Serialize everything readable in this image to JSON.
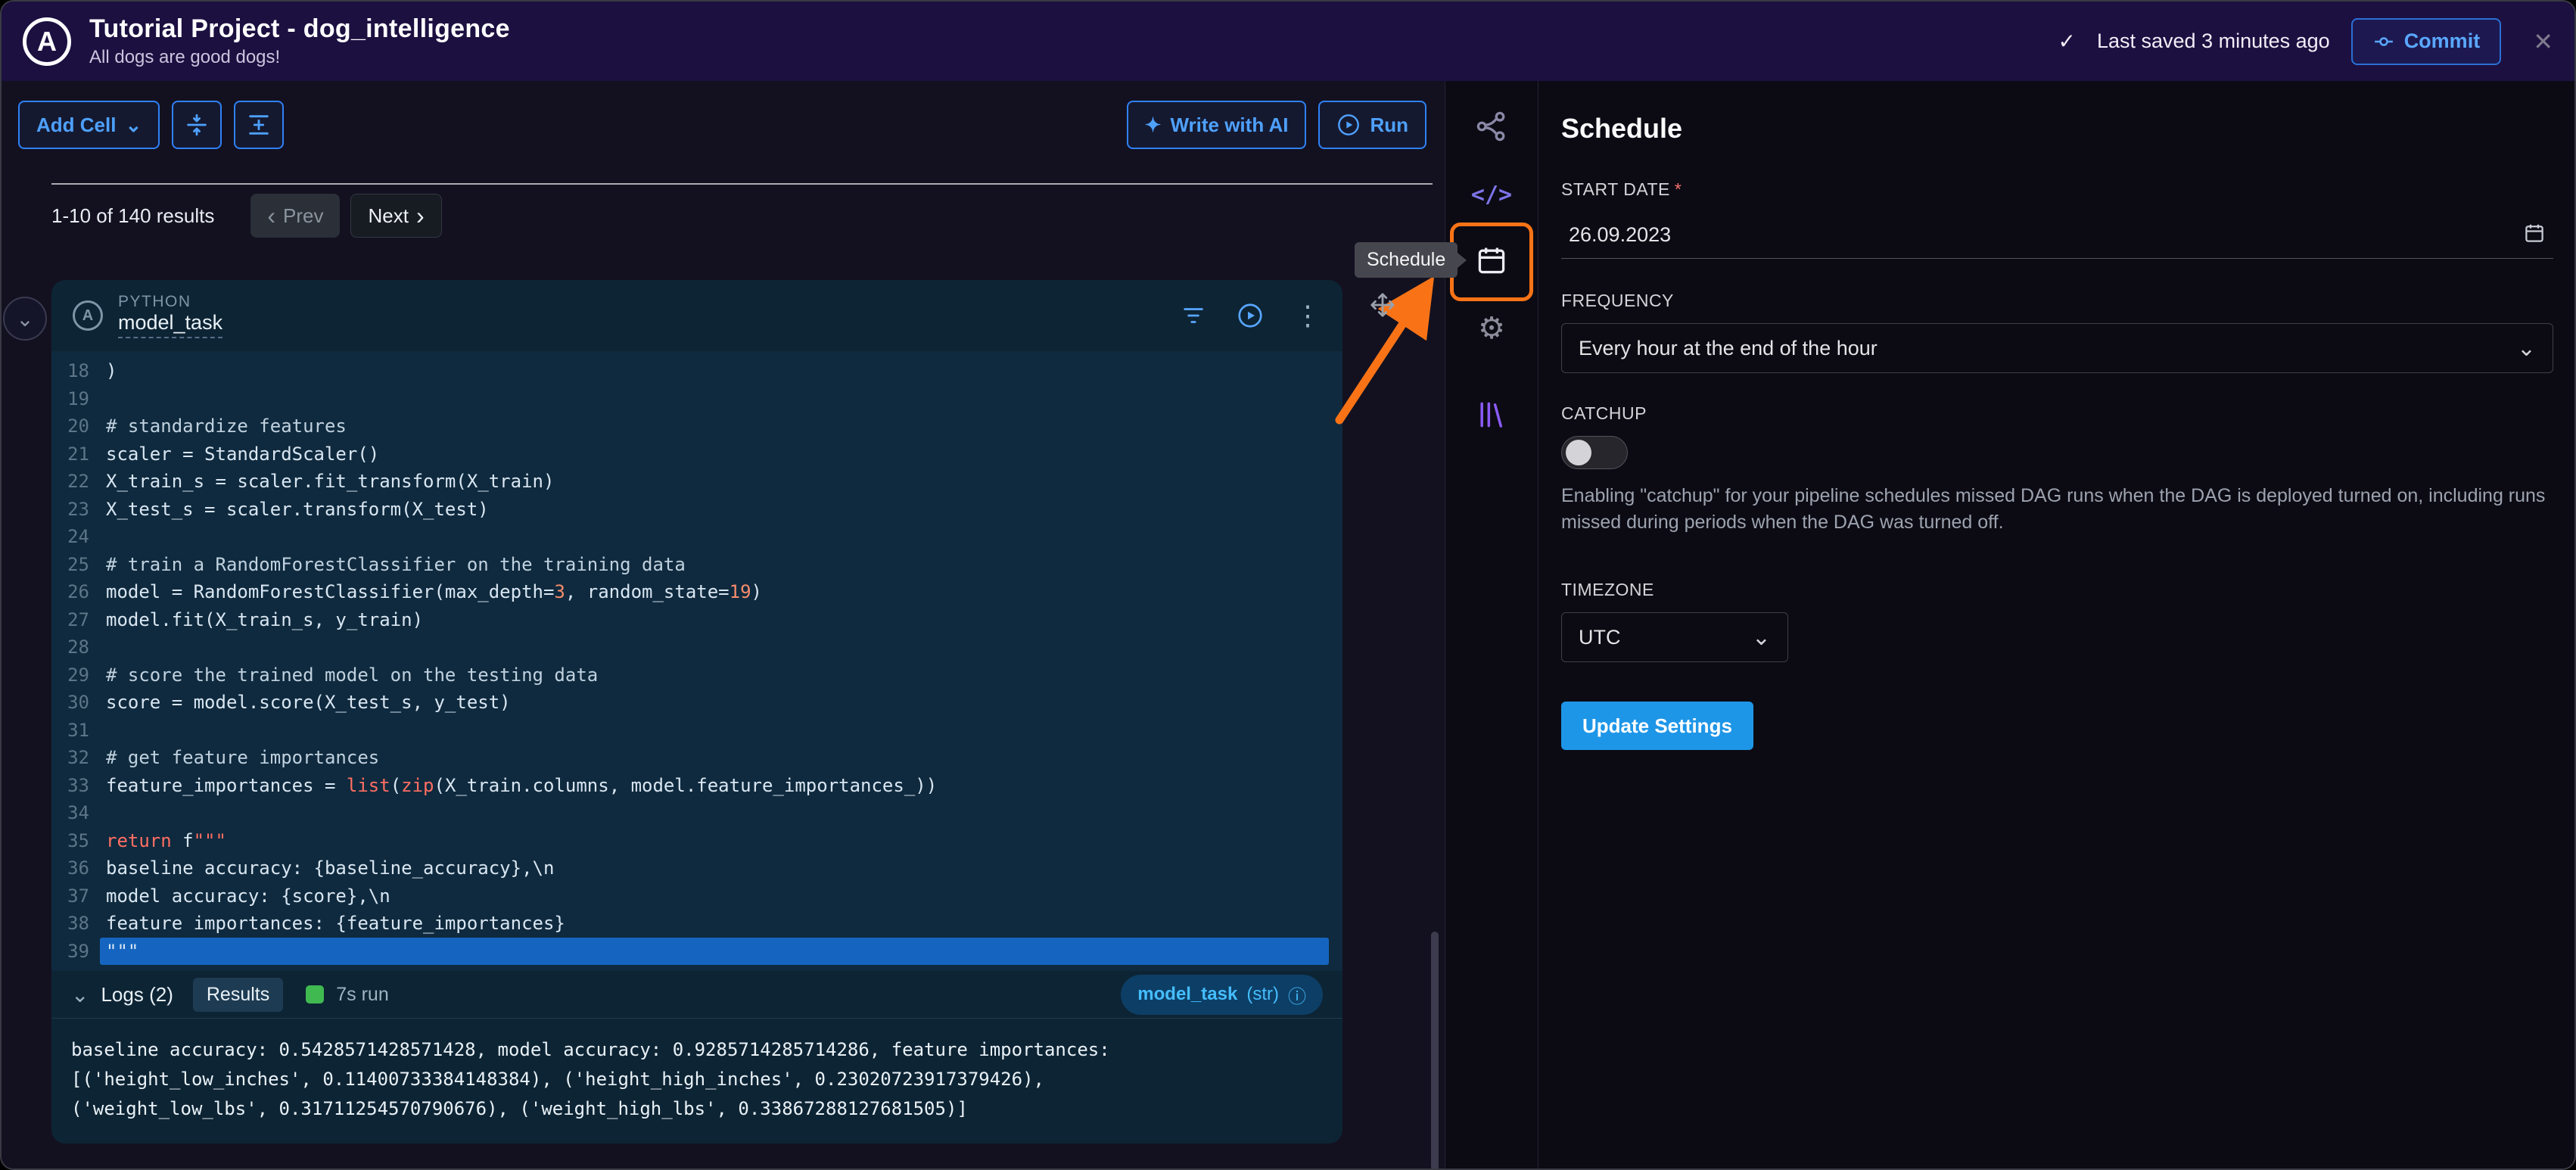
{
  "header": {
    "title": "Tutorial Project - dog_intelligence",
    "subtitle": "All dogs are good dogs!",
    "last_saved": "Last saved 3 minutes ago",
    "commit_label": "Commit"
  },
  "toolbar": {
    "add_cell": "Add Cell",
    "write_ai": "Write with AI",
    "run": "Run"
  },
  "results_bar": {
    "summary": "1-10 of 140 results",
    "prev": "Prev",
    "next": "Next"
  },
  "cell": {
    "language": "PYTHON",
    "name": "model_task",
    "code": [
      {
        "n": "18",
        "segs": [
          [
            "p",
            ")"
          ]
        ]
      },
      {
        "n": "19",
        "segs": []
      },
      {
        "n": "20",
        "segs": [
          [
            "c",
            "# standardize features"
          ]
        ]
      },
      {
        "n": "21",
        "segs": [
          [
            "p",
            "scaler = StandardScaler()"
          ]
        ]
      },
      {
        "n": "22",
        "segs": [
          [
            "p",
            "X_train_s = scaler.fit_transform(X_train)"
          ]
        ]
      },
      {
        "n": "23",
        "segs": [
          [
            "p",
            "X_test_s = scaler.transform(X_test)"
          ]
        ]
      },
      {
        "n": "24",
        "segs": []
      },
      {
        "n": "25",
        "segs": [
          [
            "c",
            "# train a RandomForestClassifier on the training data"
          ]
        ]
      },
      {
        "n": "26",
        "segs": [
          [
            "p",
            "model = RandomForestClassifier(max_depth="
          ],
          [
            "n",
            "3"
          ],
          [
            "p",
            ", random_state="
          ],
          [
            "n",
            "19"
          ],
          [
            "p",
            ")"
          ]
        ]
      },
      {
        "n": "27",
        "segs": [
          [
            "p",
            "model.fit(X_train_s, y_train)"
          ]
        ]
      },
      {
        "n": "28",
        "segs": []
      },
      {
        "n": "29",
        "segs": [
          [
            "c",
            "# score the trained model on the testing data"
          ]
        ]
      },
      {
        "n": "30",
        "segs": [
          [
            "p",
            "score = model.score(X_test_s, y_test)"
          ]
        ]
      },
      {
        "n": "31",
        "segs": []
      },
      {
        "n": "32",
        "segs": [
          [
            "c",
            "# get feature importances"
          ]
        ]
      },
      {
        "n": "33",
        "segs": [
          [
            "p",
            "feature_importances = "
          ],
          [
            "k",
            "list"
          ],
          [
            "p",
            "("
          ],
          [
            "k",
            "zip"
          ],
          [
            "p",
            "(X_train.columns, model.feature_importances_))"
          ]
        ]
      },
      {
        "n": "34",
        "segs": []
      },
      {
        "n": "35",
        "segs": [
          [
            "k",
            "return"
          ],
          [
            "p",
            " f"
          ],
          [
            "k",
            "\"\"\""
          ]
        ]
      },
      {
        "n": "36",
        "segs": [
          [
            "p",
            "baseline accuracy: {baseline_accuracy},\\n"
          ]
        ]
      },
      {
        "n": "37",
        "segs": [
          [
            "p",
            "model accuracy: {score},\\n"
          ]
        ]
      },
      {
        "n": "38",
        "segs": [
          [
            "p",
            "feature importances: {feature_importances}"
          ]
        ]
      },
      {
        "n": "39",
        "hl": true,
        "segs": [
          [
            "p",
            "\"\"\""
          ]
        ]
      }
    ],
    "footer": {
      "logs": "Logs (2)",
      "results_tab": "Results",
      "runtime": "7s run",
      "badge_name": "model_task",
      "badge_type": "(str)"
    },
    "output": [
      "baseline accuracy: 0.5428571428571428, model accuracy: 0.9285714285714286, feature importances:",
      "[('height_low_inches', 0.11400733384148384), ('height_high_inches', 0.23020723917379426),",
      "('weight_low_lbs', 0.31711254570790676), ('weight_high_lbs', 0.33867288127681505)]"
    ]
  },
  "rail": {
    "tooltip": "Schedule"
  },
  "panel": {
    "title": "Schedule",
    "start_date_label": "START DATE",
    "required_mark": "*",
    "start_date_value": "26.09.2023",
    "frequency_label": "FREQUENCY",
    "frequency_value": "Every hour at the end of the hour",
    "catchup_label": "CATCHUP",
    "catchup_description": "Enabling \"catchup\" for your pipeline schedules missed DAG runs when the DAG is deployed turned on, including runs missed during periods when the DAG was turned off.",
    "timezone_label": "TIMEZONE",
    "timezone_value": "UTC",
    "update_button": "Update Settings"
  },
  "icons": {
    "logo_letter": "A",
    "check": "✓",
    "close": "✕",
    "chevron_down": "⌄",
    "prev_chevron": "‹",
    "next_chevron": "›",
    "sparkle": "✦",
    "kebab": "⋮",
    "info": "ⓘ",
    "gear": "⚙",
    "code_glyph": "</>"
  },
  "colors": {
    "accent_blue": "#2f81f7",
    "annotation_orange": "#f97316",
    "highlight_line": "#1565c0",
    "run_green": "#3fb950",
    "badge_blue": "#45bdfd",
    "header_purple": "#1c1041",
    "cell_bg": "#0d2434"
  }
}
